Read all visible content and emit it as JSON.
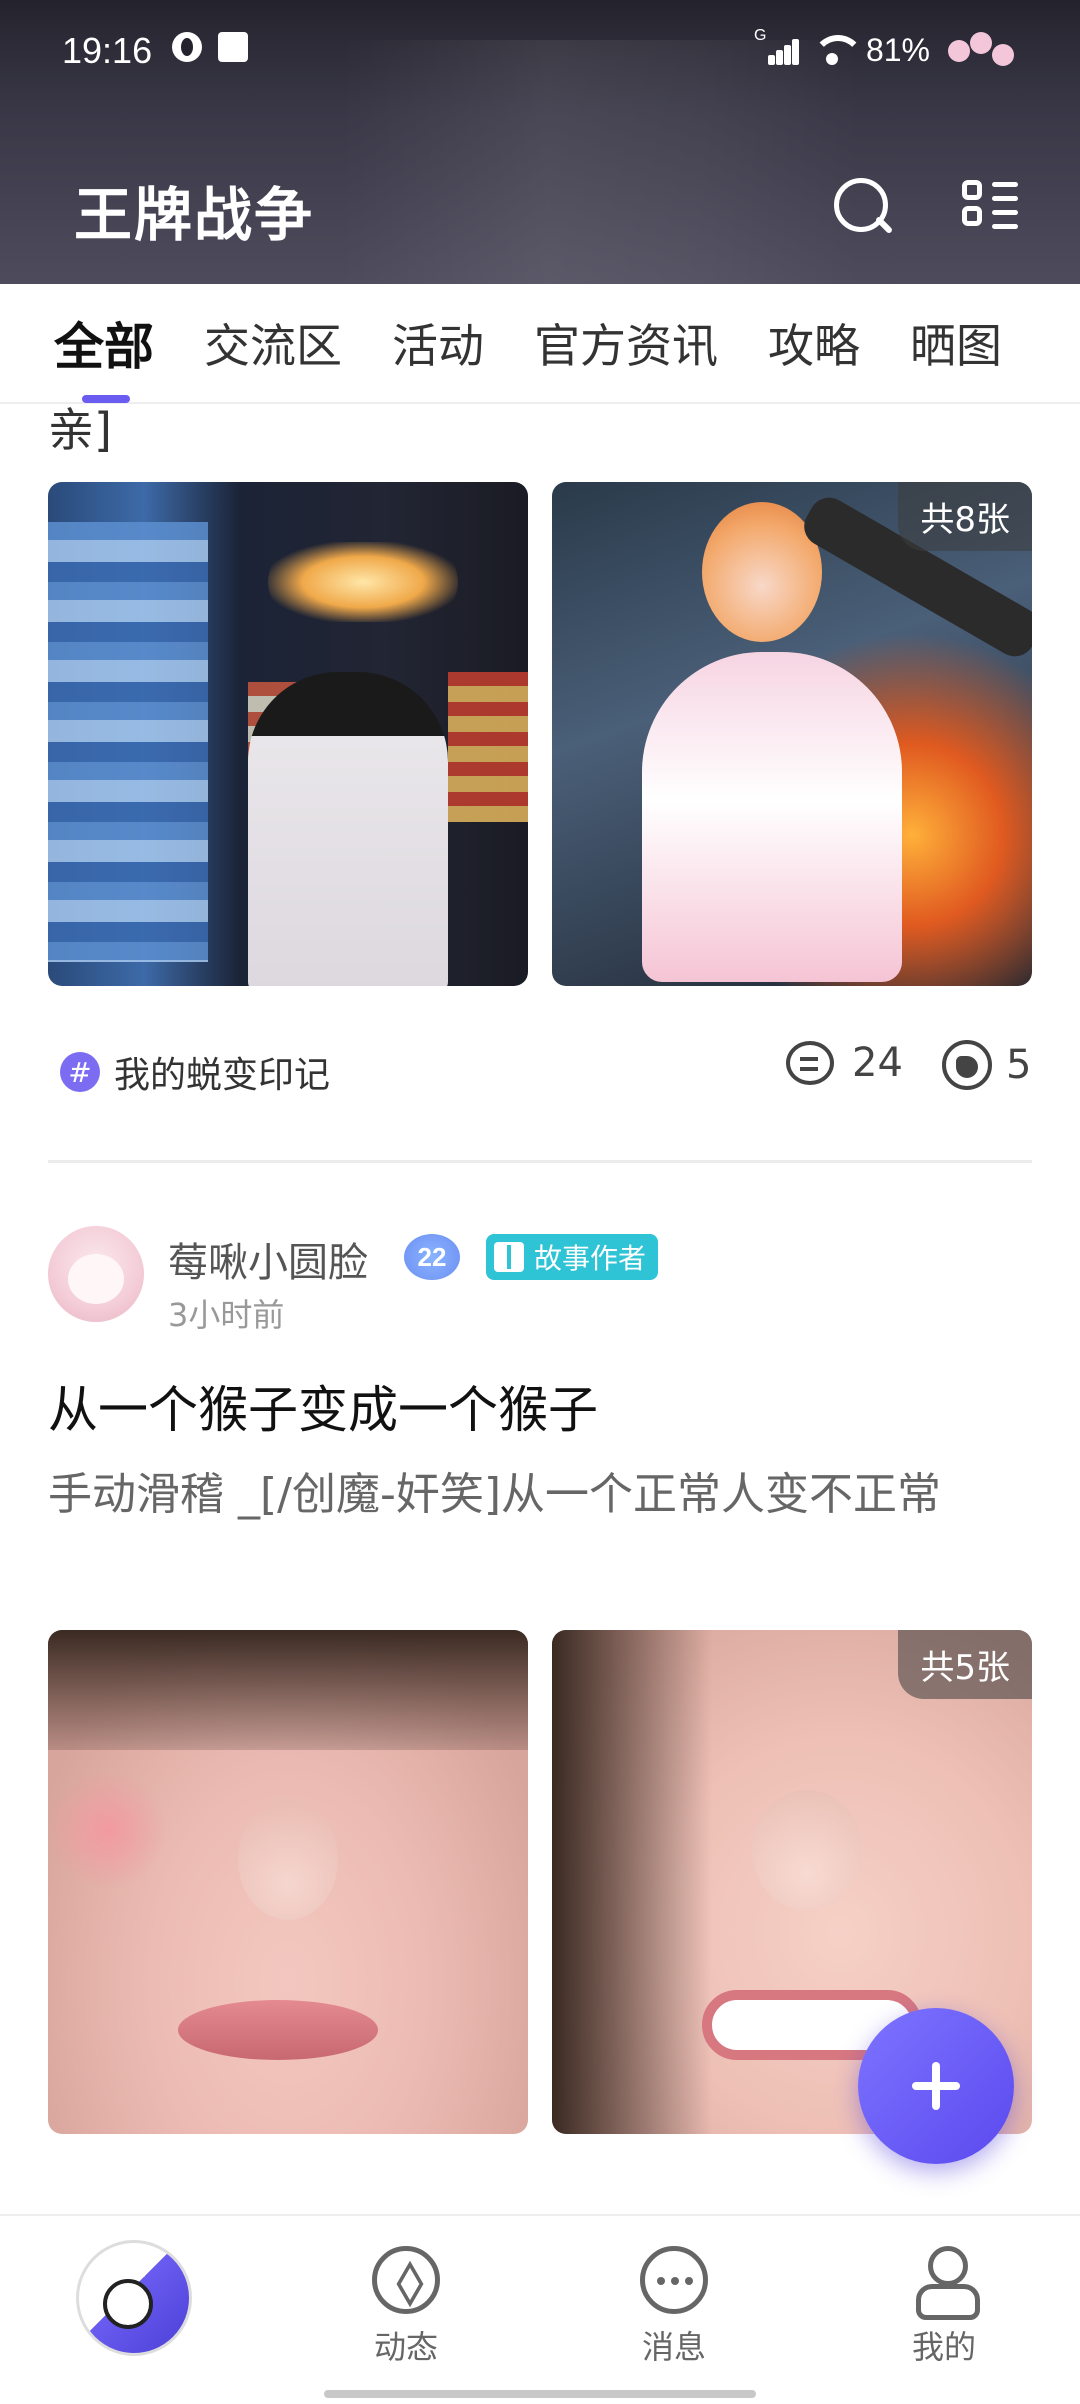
{
  "status_bar": {
    "time": "19:16",
    "network": "G",
    "battery": "81%"
  },
  "header": {
    "title": "王牌战争"
  },
  "tabs": [
    "全部",
    "交流区",
    "活动",
    "官方资讯",
    "攻略",
    "晒图"
  ],
  "posts": [
    {
      "text_fragment": "亲]",
      "image_count_label": "共8张",
      "topic": "我的蜕变印记",
      "comments": "24",
      "likes": "5"
    },
    {
      "author": "莓啾小圆脸",
      "level": "22",
      "author_badge": "故事作者",
      "time_ago": "3小时前",
      "title": "从一个猴子变成一个猴子",
      "body": "手动滑稽 _[/创魔-奸笑]从一个正常人变不正常",
      "image_count_label": "共5张"
    }
  ],
  "bottom_nav": [
    {
      "label": "动态",
      "icon": "compass-icon"
    },
    {
      "label": "消息",
      "icon": "chat-icon"
    },
    {
      "label": "我的",
      "icon": "user-icon"
    }
  ],
  "colors": {
    "accent": "#6a5cf0",
    "badge": "#2fc3d6",
    "header_bg": "#3a3847"
  }
}
